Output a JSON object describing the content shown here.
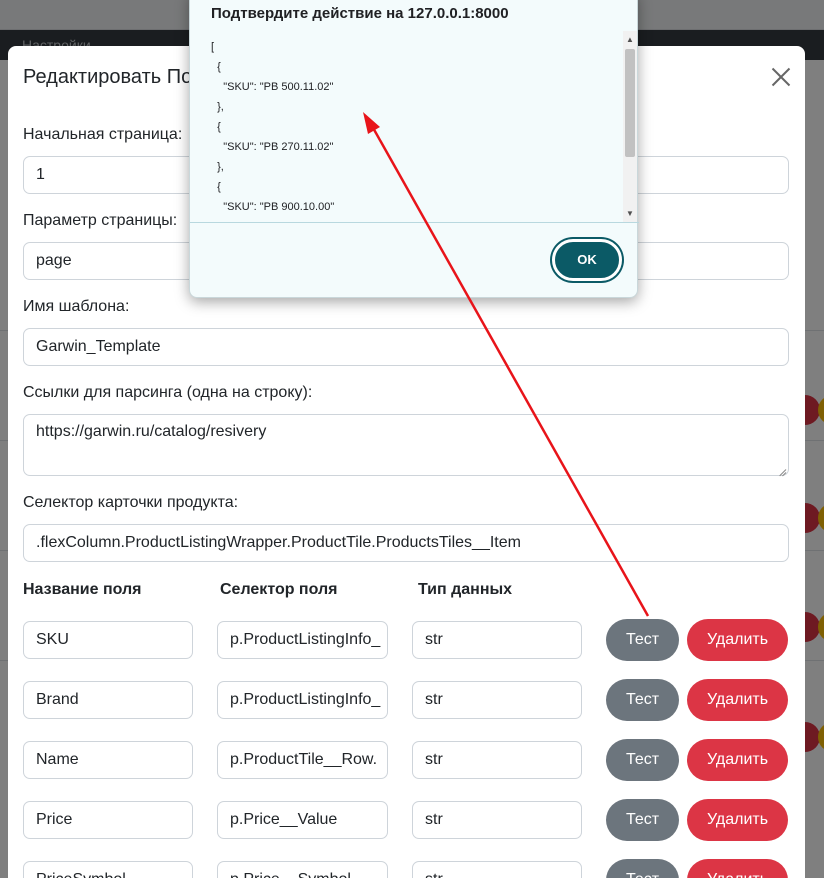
{
  "background": {
    "nav_item": "Настройки"
  },
  "modal": {
    "title": "Редактировать По",
    "fields": {
      "start_page_label": "Начальная страница:",
      "start_page_value": "1",
      "page_param_label": "Параметр страницы:",
      "page_param_value": "page",
      "template_name_label": "Имя шаблона:",
      "template_name_value": "Garwin_Template",
      "links_label": "Ссылки для парсинга (одна на строку):",
      "links_value": "https://garwin.ru/catalog/resivery",
      "card_selector_label": "Селектор карточки продукта:",
      "card_selector_value": ".flexColumn.ProductListingWrapper.ProductTile.ProductsTiles__Item"
    },
    "table_headers": {
      "field_name": "Название поля",
      "field_selector": "Селектор поля",
      "data_type": "Тип данных"
    },
    "rows": [
      {
        "name": "SKU",
        "selector": "p.ProductListingInfo_",
        "type": "str",
        "test": "Тест",
        "delete": "Удалить"
      },
      {
        "name": "Brand",
        "selector": "p.ProductListingInfo_",
        "type": "str",
        "test": "Тест",
        "delete": "Удалить"
      },
      {
        "name": "Name",
        "selector": "p.ProductTile__Row.",
        "type": "str",
        "test": "Тест",
        "delete": "Удалить"
      },
      {
        "name": "Price",
        "selector": "p.Price__Value",
        "type": "str",
        "test": "Тест",
        "delete": "Удалить"
      },
      {
        "name": "PriceSymbol",
        "selector": "p.Price__Symbol",
        "type": "str",
        "test": "Тест",
        "delete": "Удалить"
      }
    ]
  },
  "dialog": {
    "title": "Подтвердите действие на 127.0.0.1:8000",
    "json_text": "[\n  {\n    \"SKU\": \"PB 500.11.02\"\n  },\n  {\n    \"SKU\": \"PB 270.11.02\"\n  },\n  {\n    \"SKU\": \"PB 900.10.00\"\n  }",
    "ok_label": "OK"
  },
  "colors": {
    "test_button": "#6c757d",
    "delete_button": "#dc3545",
    "ok_button": "#0b5a66",
    "annotation_arrow": "#e8141a"
  }
}
